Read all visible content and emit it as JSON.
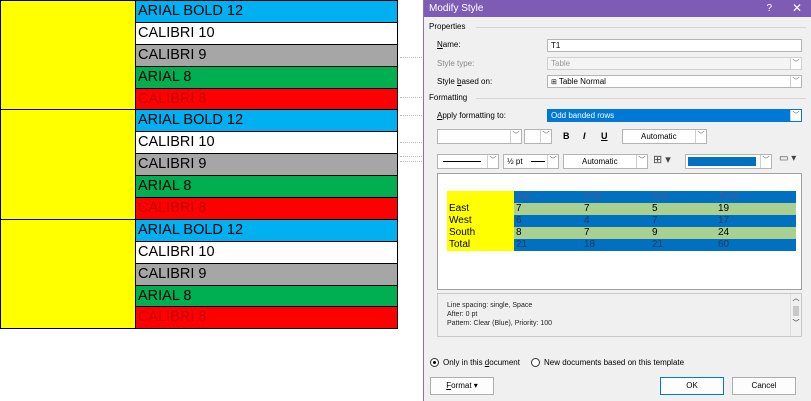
{
  "doc": {
    "groups": [
      {
        "rows": [
          {
            "text": "ARIAL BOLD 12",
            "color": "blue"
          },
          {
            "text": "CALIBRI 10",
            "color": "white"
          },
          {
            "text": "CALIBRI 9",
            "color": "gray"
          },
          {
            "text": "ARIAL 8",
            "color": "green"
          },
          {
            "text": "CALIBRI 8",
            "color": "red"
          }
        ]
      },
      {
        "rows": [
          {
            "text": "ARIAL BOLD 12",
            "color": "blue"
          },
          {
            "text": "CALIBRI 10",
            "color": "white"
          },
          {
            "text": "CALIBRI 9",
            "color": "gray"
          },
          {
            "text": "ARIAL 8",
            "color": "green"
          },
          {
            "text": "CALIBRI 8",
            "color": "red"
          }
        ]
      },
      {
        "rows": [
          {
            "text": "ARIAL BOLD 12",
            "color": "blue"
          },
          {
            "text": "CALIBRI 10",
            "color": "white"
          },
          {
            "text": "CALIBRI 9",
            "color": "gray"
          },
          {
            "text": "ARIAL 8",
            "color": "green"
          },
          {
            "text": "CALIBRI 8",
            "color": "red"
          }
        ]
      }
    ]
  },
  "dialog": {
    "title": "Modify Style",
    "help": "?",
    "close": "✕",
    "properties_heading": "Properties",
    "name_label": "Name:",
    "name_value": "T1",
    "style_type_label": "Style type:",
    "style_type_value": "Table",
    "based_on_label": "Style based on:",
    "based_on_value": "Table Normal",
    "based_on_icon": "table-icon",
    "formatting_heading": "Formatting",
    "apply_label": "Apply formatting to:",
    "apply_value": "Odd banded rows",
    "bold": "B",
    "italic": "I",
    "underline": "U",
    "font_color": "Automatic",
    "border_weight": "½ pt",
    "border_color": "Automatic",
    "shading_color": "#0070c0",
    "preview": {
      "header": [
        "",
        "Jan",
        "Feb",
        "Mar",
        "Total"
      ],
      "rows": [
        [
          "East",
          "7",
          "7",
          "5",
          "19"
        ],
        [
          "West",
          "6",
          "4",
          "7",
          "17"
        ],
        [
          "South",
          "8",
          "7",
          "9",
          "24"
        ],
        [
          "Total",
          "21",
          "18",
          "21",
          "60"
        ]
      ]
    },
    "description": [
      "Line spacing:  single, Space",
      "After:  0 pt",
      "Pattern: Clear (Blue), Priority: 100"
    ],
    "only_this_doc": "Only in this document",
    "new_docs": "New documents based on this template",
    "format_button": "Format ▾",
    "ok_button": "OK",
    "cancel_button": "Cancel"
  },
  "colors": {
    "blue": "#00b0f0",
    "gray": "#a6a6a6",
    "green": "#00b050",
    "red": "#ff0000",
    "yellow": "#ffff00",
    "titlebar": "#7e5cb5",
    "selection": "#0078d7"
  }
}
